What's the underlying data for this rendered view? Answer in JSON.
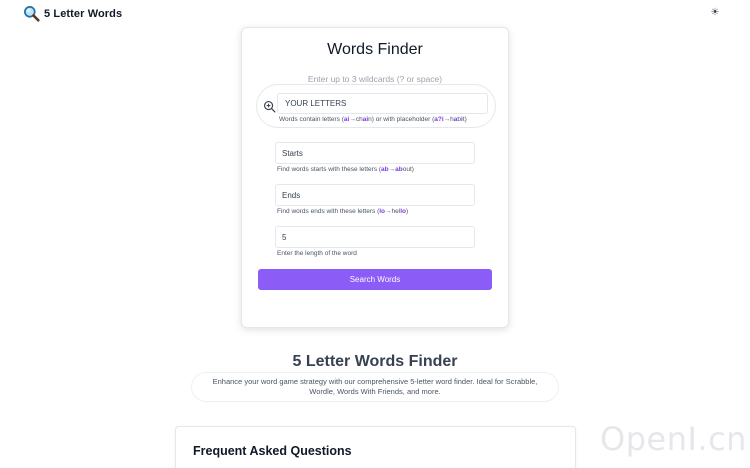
{
  "header": {
    "logo_icon": "magnifier-icon",
    "title": "5 Letter Words",
    "theme_icon": "sun-icon",
    "theme_glyph": "☀"
  },
  "finder": {
    "title": "Words Finder",
    "wildcard_hint": "Enter up to 3 wildcards (? or space)",
    "letters": {
      "placeholder": "YOUR LETTERS",
      "help_prefix": "Words contain letters (",
      "ex1_a": "ai",
      "ex1_arrow": "→",
      "ex1_b1": "ch",
      "ex1_b2": "ai",
      "ex1_b3": "n",
      "help_mid": ") or with placeholder (",
      "ex2_a": "a?i",
      "ex2_arrow": "→",
      "ex2_b1": "h",
      "ex2_b2": "a",
      "ex2_b3": "b",
      "ex2_b4": "i",
      "ex2_b5": "t",
      "help_suffix": ")"
    },
    "starts": {
      "placeholder": "Starts",
      "help_prefix": "Find words starts with these letters (",
      "ex_a": "ab",
      "ex_arrow": "→",
      "ex_b1": "ab",
      "ex_b2": "out",
      "help_suffix": ")"
    },
    "ends": {
      "placeholder": "Ends",
      "help_prefix": "Find words ends with these letters (",
      "ex_a": "lo",
      "ex_arrow": "→",
      "ex_b1": "hel",
      "ex_b2": "lo",
      "help_suffix": ")"
    },
    "length": {
      "value": "5",
      "help": "Enter the length of the word"
    },
    "button_label": "Search Words"
  },
  "intro": {
    "title": "5 Letter Words Finder",
    "description": "Enhance your word game strategy with our comprehensive 5-letter word finder. Ideal for Scrabble, Wordle, Words With Friends, and more."
  },
  "faq": {
    "title": "Frequent Asked Questions"
  },
  "watermark": "OpenI.cn",
  "colors": {
    "accent": "#8b5cf6",
    "highlight": "#7c3aed"
  }
}
